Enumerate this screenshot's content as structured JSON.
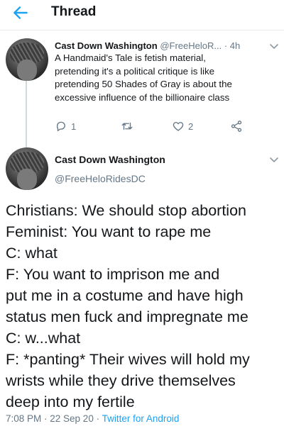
{
  "header": {
    "title": "Thread"
  },
  "tweet1": {
    "name": "Cast Down Washington",
    "handle": "@FreeHeloR...",
    "time": "· 4h",
    "lines": [
      "A Handmaid's Tale is fetish material,",
      "pretending it's a political critique is like",
      "pretending 50 Shades of Gray is about the",
      "excessive influence of the billionaire class"
    ],
    "reply_count": "1",
    "retweet_count": "",
    "like_count": "2"
  },
  "tweet2": {
    "name": "Cast Down Washington",
    "handle": "@FreeHeloRidesDC",
    "lines": [
      "Christians: We should stop abortion",
      "Feminist: You want to rape me",
      "C: what",
      "F: You want to imprison me and",
      "put me in a costume and have high",
      "status men fuck and impregnate me",
      "C: w...what",
      "F: *panting* Their wives will hold my",
      "wrists while they drive themselves",
      "deep into my fertile"
    ],
    "meta_time": "7:08 PM · 22 Sep 20 · ",
    "meta_source": "Twitter for Android"
  },
  "colors": {
    "accent": "#1da1f2",
    "muted": "#657786",
    "text": "#14171a"
  },
  "icons": [
    "back-arrow-icon",
    "chevron-down-icon",
    "reply-icon",
    "retweet-icon",
    "like-icon",
    "share-icon"
  ]
}
